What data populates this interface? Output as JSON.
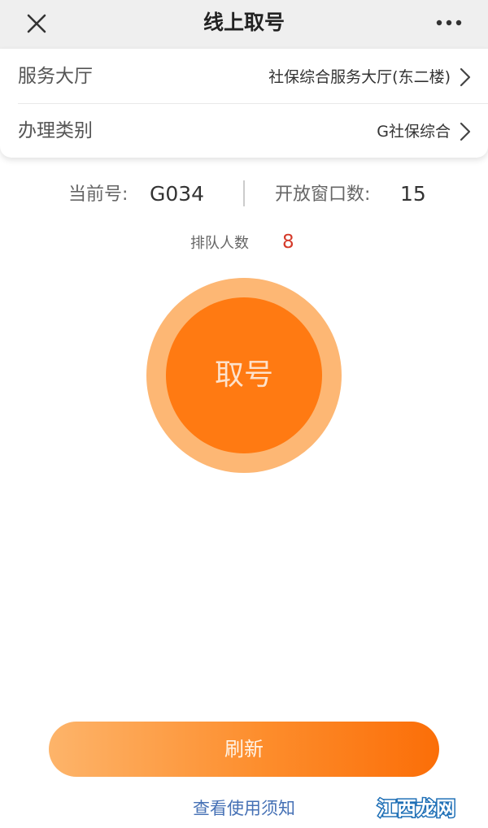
{
  "header": {
    "title": "线上取号",
    "close_icon": "close-icon",
    "more_icon": "more-horizontal-icon"
  },
  "info": {
    "hall_label": "服务大厅",
    "hall_value": "社保综合服务大厅(东二楼)",
    "category_label": "办理类别",
    "category_value": "G社保综合",
    "chevron_icon": "chevron-right-icon"
  },
  "stats": {
    "current_label": "当前号:",
    "current_value": "G034",
    "windows_label": "开放窗口数:",
    "windows_value": "15",
    "queue_label": "排队人数",
    "queue_value": "8"
  },
  "take_number": {
    "label": "取号"
  },
  "refresh": {
    "label": "刷新"
  },
  "notice": {
    "label": "查看使用须知"
  },
  "watermark": {
    "text": "江西龙网"
  },
  "colors": {
    "accent": "#ff7a12",
    "accent_light": "#fdb774",
    "queue_value": "#d53a2a",
    "link": "#4671b5",
    "topbar_bg": "#efefef"
  }
}
